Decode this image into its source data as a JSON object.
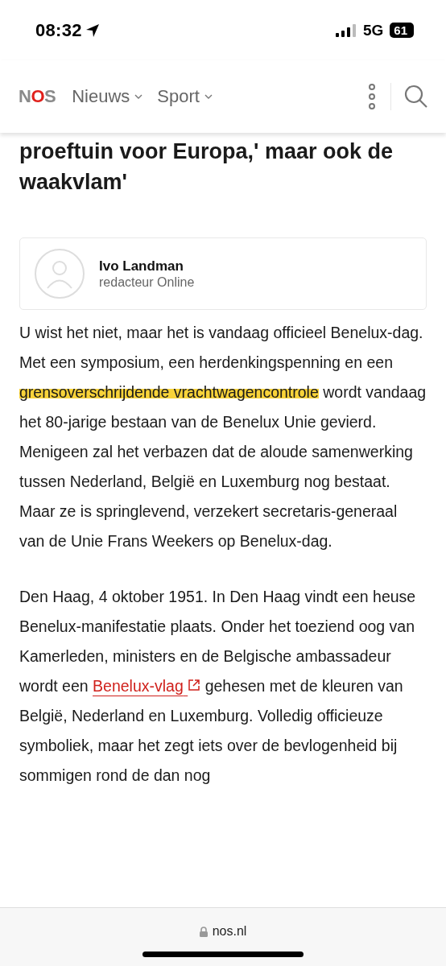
{
  "status_bar": {
    "time": "08:32",
    "network": "5G",
    "battery": "61"
  },
  "header": {
    "logo": "NOS",
    "nav": [
      {
        "label": "Nieuws"
      },
      {
        "label": "Sport"
      }
    ]
  },
  "article": {
    "headline": [
      "proeftuin voor Europa,' maar ook de",
      "waakvlam'"
    ],
    "author": {
      "name": "Ivo Landman",
      "role": "redacteur Online"
    },
    "paragraphs": [
      [
        {
          "kind": "text",
          "text": "U wist het niet, maar het is vandaag officieel Benelux-dag. Met een symposium, een herdenkingspenning en een "
        },
        {
          "kind": "highlight",
          "text": "grensoverschrijdende vrachtwagencontrole"
        },
        {
          "kind": "text",
          "text": " wordt vandaag het 80-jarige bestaan van de Benelux Unie gevierd. Menigeen zal het verbazen dat de aloude samenwerking tussen Nederland, België en Luxemburg nog bestaat. Maar ze is springlevend, verzekert secretaris-generaal van de Unie Frans Weekers op Benelux-dag."
        }
      ],
      [
        {
          "kind": "text",
          "text": "Den Haag, 4 oktober 1951. In Den Haag vindt een heuse Benelux-manifestatie plaats. Onder het toeziend oog van Kamerleden, ministers en de Belgische ambassadeur wordt een "
        },
        {
          "kind": "link",
          "text": "Benelux-vlag"
        },
        {
          "kind": "text",
          "text": " gehesen met de kleuren van België, Nederland en Luxemburg. Volledig officieuze symboliek, maar het zegt iets over de bevlogenheid bij sommigen rond de dan nog"
        }
      ]
    ]
  },
  "browser_bar": {
    "url": "nos.nl"
  }
}
